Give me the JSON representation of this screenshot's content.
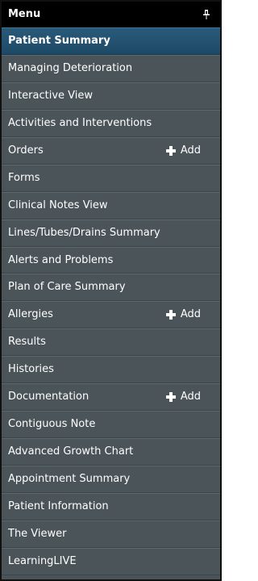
{
  "menu": {
    "title": "Menu",
    "pin_icon": "pin-icon",
    "add_label": "Add",
    "items": [
      {
        "label": "Patient Summary",
        "active": true
      },
      {
        "label": "Managing Deterioration"
      },
      {
        "label": "Interactive View"
      },
      {
        "label": "Activities and Interventions"
      },
      {
        "label": "Orders",
        "has_add": true
      },
      {
        "label": "Forms"
      },
      {
        "label": "Clinical Notes View"
      },
      {
        "label": "Lines/Tubes/Drains Summary"
      },
      {
        "label": "Alerts and Problems"
      },
      {
        "label": "Plan of Care Summary"
      },
      {
        "label": "Allergies",
        "has_add": true
      },
      {
        "label": "Results"
      },
      {
        "label": "Histories"
      },
      {
        "label": "Documentation",
        "has_add": true
      },
      {
        "label": "Contiguous Note"
      },
      {
        "label": "Advanced Growth Chart"
      },
      {
        "label": "Appointment Summary"
      },
      {
        "label": "Patient Information"
      },
      {
        "label": "The Viewer"
      },
      {
        "label": "LearningLIVE"
      }
    ]
  },
  "colors": {
    "panel_bg": "#4a5459",
    "header_bg": "#000000",
    "active_bg": "#1d4966",
    "text": "#ffffff"
  }
}
